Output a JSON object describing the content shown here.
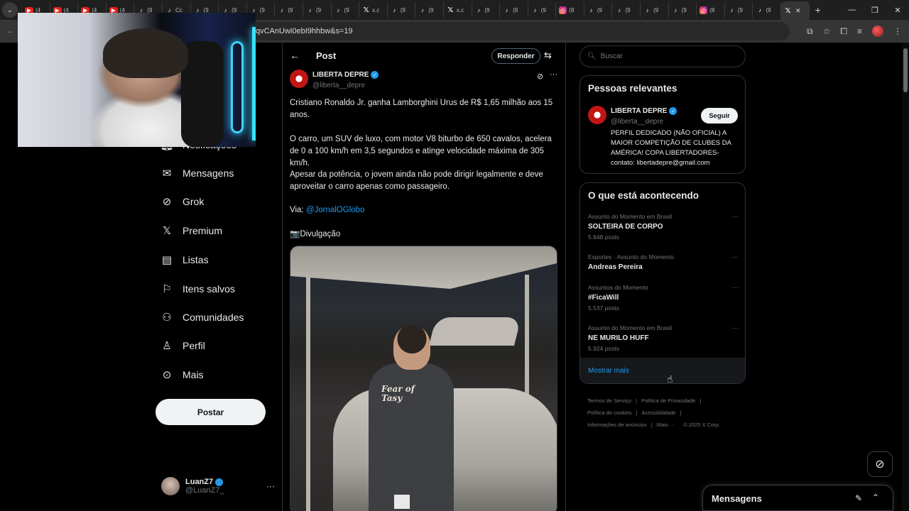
{
  "browser": {
    "tabs": [
      {
        "icon": "youtube-icon",
        "label": "(4"
      },
      {
        "icon": "youtube-icon",
        "label": "(4"
      },
      {
        "icon": "youtube-icon",
        "label": "(4"
      },
      {
        "icon": "youtube-icon",
        "label": "(4"
      },
      {
        "icon": "tiktok-icon",
        "label": "(9"
      },
      {
        "icon": "tiktok-icon",
        "label": "Cc"
      },
      {
        "icon": "tiktok-icon",
        "label": "(9"
      },
      {
        "icon": "tiktok-icon",
        "label": "(9"
      },
      {
        "icon": "tiktok-icon",
        "label": "(9"
      },
      {
        "icon": "tiktok-icon",
        "label": "(9"
      },
      {
        "icon": "tiktok-icon",
        "label": "(9"
      },
      {
        "icon": "tiktok-icon",
        "label": "(9"
      },
      {
        "icon": "x-icon",
        "label": "x.c"
      },
      {
        "icon": "tiktok-icon",
        "label": "(9"
      },
      {
        "icon": "tiktok-icon",
        "label": "(9"
      },
      {
        "icon": "x-icon",
        "label": "x.c"
      },
      {
        "icon": "tiktok-icon",
        "label": "(9"
      },
      {
        "icon": "tiktok-icon",
        "label": "(9"
      },
      {
        "icon": "tiktok-icon",
        "label": "(9"
      },
      {
        "icon": "instagram-icon",
        "label": "(8"
      },
      {
        "icon": "tiktok-icon",
        "label": "(9"
      },
      {
        "icon": "tiktok-icon",
        "label": "(9"
      },
      {
        "icon": "tiktok-icon",
        "label": "(9"
      },
      {
        "icon": "tiktok-icon",
        "label": "(9"
      },
      {
        "icon": "instagram-icon",
        "label": "(8"
      },
      {
        "icon": "tiktok-icon",
        "label": "(9"
      },
      {
        "icon": "tiktok-icon",
        "label": "(9"
      }
    ],
    "url": "qvCAnUwi0ebI9hhbw&s=19"
  },
  "nav": {
    "notifications": "Notificações",
    "messages": "Mensagens",
    "grok": "Grok",
    "premium": "Premium",
    "lists": "Listas",
    "bookmarks": "Itens salvos",
    "communities": "Comunidades",
    "profile": "Perfil",
    "more": "Mais",
    "post_button": "Postar",
    "me": {
      "name": "LuanZ7",
      "handle": "@LuanZ7_"
    }
  },
  "post": {
    "header_title": "Post",
    "reply_button": "Responder",
    "author_name": "LIBERTA DEPRE",
    "author_handle": "@liberta__depre",
    "paragraph1": "Cristiano Ronaldo Jr. ganha Lamborghini Urus de R$ 1,65 milhão aos 15 anos.",
    "paragraph2": "O carro, um SUV de luxo, com motor V8 biturbo de 650 cavalos, acelera de 0 a 100 km/h em 3,5 segundos e atinge velocidade máxima de 305 km/h.",
    "paragraph3": "Apesar da potência, o jovem ainda não pode dirigir legalmente e deve aproveitar o carro apenas como passageiro.",
    "via_label": "Via: ",
    "via_mention": "@JornalOGlobo",
    "credit": "📷Divulgação",
    "photo_hoodie_text": "Fear of Tasy"
  },
  "right": {
    "search_placeholder": "Buscar",
    "relevant": {
      "title": "Pessoas relevantes",
      "name": "LIBERTA DEPRE",
      "handle": "@liberta__depre",
      "follow": "Seguir",
      "bio": "PERFIL DEDICADO (NÃO OFICIAL) A MAIOR COMPETIÇÃO DE CLUBES DA AMÉRICA! COPA LIBERTADORES- contato: libertadepre@gmail.com"
    },
    "trending": {
      "title": "O que está acontecendo",
      "items": [
        {
          "meta": "Assunto do Momento em Brasil",
          "title": "SOLTEIRA DE CORPO",
          "count": "5.648 posts"
        },
        {
          "meta": "Esportes · Assunto do Momento",
          "title": "Andreas Pereira",
          "count": ""
        },
        {
          "meta": "Assuntos do Momento",
          "title": "#FicaWill",
          "count": "5.537 posts"
        },
        {
          "meta": "Assunto do Momento em Brasil",
          "title": "NE MURILO HUFF",
          "count": "5.924 posts"
        }
      ],
      "show_more": "Mostrar mais"
    },
    "footer": {
      "terms": "Termos de Serviço",
      "privacy": "Política de Privacidade",
      "cookies": "Política de cookies",
      "accessibility": "Acessibilidade",
      "ads": "Informações de anúncios",
      "more": "Mais ···",
      "copyright": "© 2025 X Corp."
    }
  },
  "messages_drawer": {
    "title": "Mensagens"
  },
  "colors": {
    "accent": "#1d9bf0",
    "background": "#000000",
    "border": "#2f3336",
    "muted": "#71767b"
  }
}
